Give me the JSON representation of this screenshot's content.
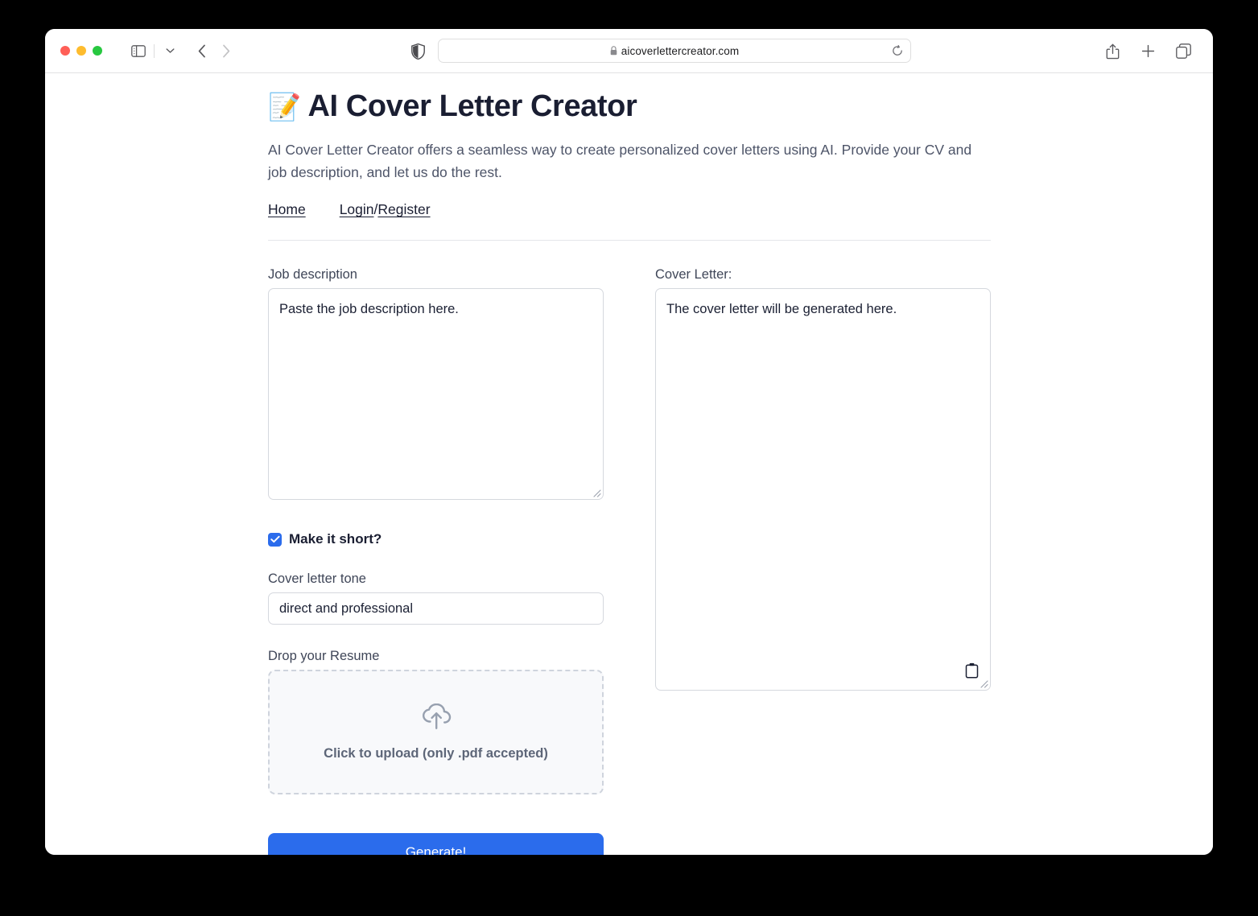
{
  "browser": {
    "url": "aicoverlettercreator.com",
    "lock_icon": "lock-icon",
    "traffic_lights": [
      "close-button",
      "minimize-button",
      "maximize-button"
    ],
    "toolbar_icons": [
      "sidebar-toggle-icon",
      "chevron-down-icon",
      "back-arrow-icon",
      "forward-arrow-icon",
      "shield-privacy-icon",
      "reload-icon",
      "share-icon",
      "new-tab-icon",
      "tab-overview-icon"
    ]
  },
  "page": {
    "title_emoji": "📝",
    "title": "AI Cover Letter Creator",
    "description": "AI Cover Letter Creator offers a seamless way to create personalized cover letters using AI. Provide your CV and job description, and let us do the rest.",
    "nav": {
      "home": "Home",
      "login": "Login",
      "separator": "/",
      "register": "Register"
    }
  },
  "form": {
    "job_description": {
      "label": "Job description",
      "value": "Paste the job description here.",
      "placeholder": "Paste the job description here."
    },
    "make_it_short": {
      "label": "Make it short?",
      "checked": true,
      "check_glyph": "✓"
    },
    "tone": {
      "label": "Cover letter tone",
      "value": "direct and professional",
      "placeholder": "direct and professional"
    },
    "resume_upload": {
      "label": "Drop your Resume",
      "icon": "cloud-upload-icon",
      "text": "Click to upload (only .pdf accepted)"
    },
    "generate_button": "Generate!"
  },
  "output": {
    "label": "Cover Letter:",
    "value": "The cover letter will be generated here.",
    "copy_icon": "clipboard-copy-icon"
  },
  "colors": {
    "accent_blue": "#2b6cec",
    "title_navy": "#1a1e32",
    "body_gray": "#4d5468",
    "border_gray": "#d5d8de",
    "dropzone_bg": "#f8f9fb",
    "dropzone_border": "#cfd4dd"
  }
}
